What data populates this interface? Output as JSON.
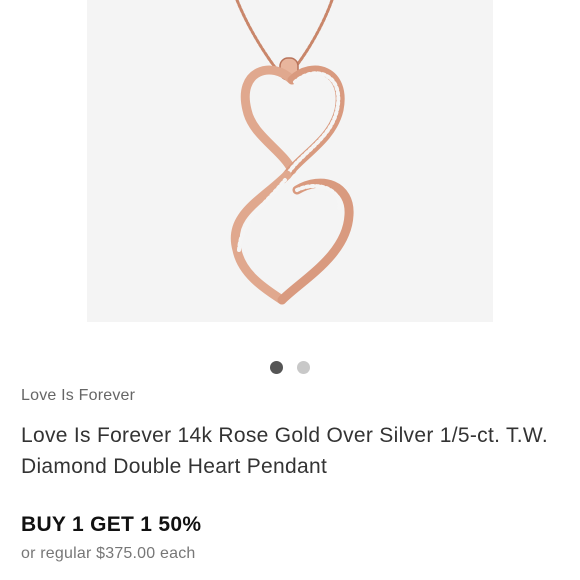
{
  "product": {
    "image_alt": "rose gold double heart diamond pendant",
    "brand": "Love Is Forever",
    "title": "Love Is Forever 14k Rose Gold Over Silver 1/5-ct. T.W. Diamond Double Heart Pendant",
    "promo": "BUY 1 GET 1 50%",
    "regular_price": "or regular $375.00 each"
  },
  "carousel": {
    "active_index": 0,
    "count": 2
  },
  "colors": {
    "rose_gold": "#e0a88e",
    "rose_gold_dark": "#b8735a",
    "chain": "#c9866a",
    "dot_active": "#555555",
    "dot_inactive": "#c8c8c8"
  }
}
